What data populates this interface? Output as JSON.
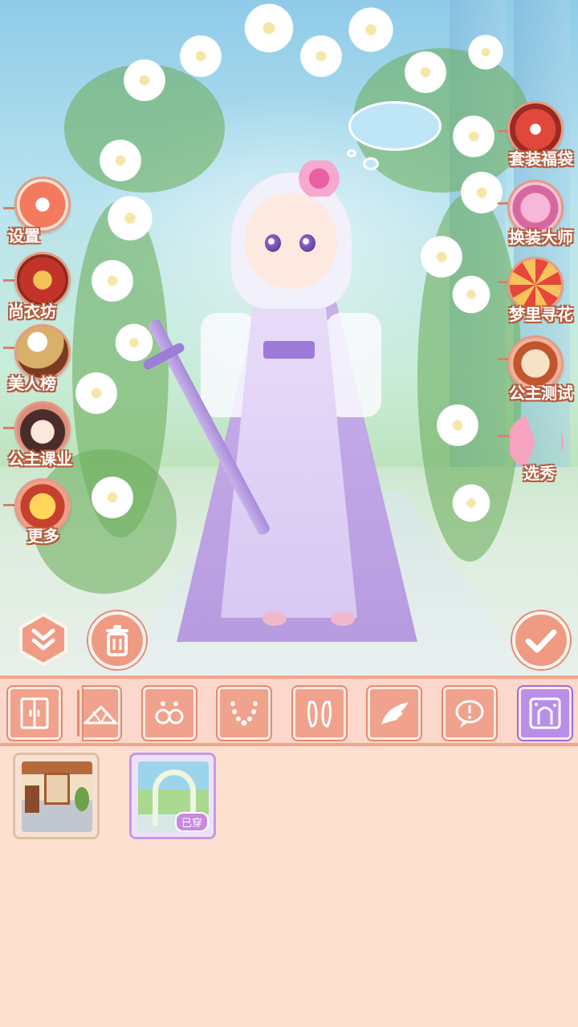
{
  "left_menu": [
    {
      "id": "settings",
      "label": "设置",
      "icon": "gear-icon"
    },
    {
      "id": "wardrobe",
      "label": "尚衣坊",
      "icon": "wardrobe-shop-icon"
    },
    {
      "id": "beauty_ranking",
      "label": "美人榜",
      "icon": "ranking-scroll-icon"
    },
    {
      "id": "princess_lessons",
      "label": "公主课业",
      "icon": "princess-avatar-icon"
    },
    {
      "id": "more",
      "label": "更多",
      "icon": "treasure-chest-icon"
    }
  ],
  "right_menu": [
    {
      "id": "outfit_bag",
      "label": "套装福袋",
      "icon": "lucky-bag-icon"
    },
    {
      "id": "dressup_master",
      "label": "换装大师",
      "icon": "gift-box-icon"
    },
    {
      "id": "dream_flower",
      "label": "梦里寻花",
      "icon": "wheel-icon"
    },
    {
      "id": "princess_test",
      "label": "公主测试",
      "icon": "scroll-brush-icon"
    },
    {
      "id": "selection",
      "label": "选秀",
      "icon": "fan-icon"
    }
  ],
  "actions": {
    "collapse_icon": "double-chevron-down-icon",
    "delete_icon": "trash-icon",
    "confirm_icon": "checkmark-icon"
  },
  "categories": [
    {
      "id": "wardrobe",
      "icon": "wardrobe-door-icon",
      "active": false
    },
    {
      "id": "fan",
      "icon": "fan-icon",
      "active": false
    },
    {
      "id": "earrings",
      "icon": "earrings-icon",
      "active": false
    },
    {
      "id": "necklace",
      "icon": "necklace-icon",
      "active": false
    },
    {
      "id": "shoes",
      "icon": "shoes-icon",
      "active": false
    },
    {
      "id": "wings",
      "icon": "wing-icon",
      "active": false
    },
    {
      "id": "speech",
      "icon": "speech-bubble-icon",
      "active": false
    },
    {
      "id": "background",
      "icon": "background-scene-icon",
      "active": true
    }
  ],
  "items": [
    {
      "id": "bg_room",
      "name": "room-background",
      "worn": false
    },
    {
      "id": "bg_garden",
      "name": "garden-arch-background",
      "worn": true,
      "badge": "已穿"
    }
  ],
  "colors": {
    "accent": "#f1a28c",
    "active_tab": "#b98ee8",
    "panel_bg": "#fde0d0",
    "label_outline": "#b65a3c"
  }
}
